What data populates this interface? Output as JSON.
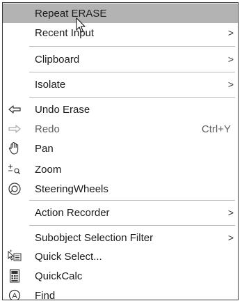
{
  "menu": {
    "items": [
      {
        "label": "Repeat ERASE",
        "icon": "",
        "submenu": false,
        "shortcut": "",
        "highlighted": true
      },
      {
        "label": "Recent Input",
        "icon": "",
        "submenu": true,
        "shortcut": ""
      },
      {
        "label": "Clipboard",
        "icon": "",
        "submenu": true,
        "shortcut": ""
      },
      {
        "label": "Isolate",
        "icon": "",
        "submenu": true,
        "shortcut": ""
      },
      {
        "label": "Undo Erase",
        "icon": "undo-icon",
        "submenu": false,
        "shortcut": ""
      },
      {
        "label": "Redo",
        "icon": "redo-icon",
        "submenu": false,
        "shortcut": "Ctrl+Y",
        "disabled": true
      },
      {
        "label": "Pan",
        "icon": "pan-hand-icon",
        "submenu": false,
        "shortcut": ""
      },
      {
        "label": "Zoom",
        "icon": "zoom-icon",
        "submenu": false,
        "shortcut": ""
      },
      {
        "label": "SteeringWheels",
        "icon": "steeringwheels-icon",
        "submenu": false,
        "shortcut": ""
      },
      {
        "label": "Action Recorder",
        "icon": "",
        "submenu": true,
        "shortcut": ""
      },
      {
        "label": "Subobject Selection Filter",
        "icon": "",
        "submenu": true,
        "shortcut": ""
      },
      {
        "label": "Quick Select...",
        "icon": "quick-select-icon",
        "submenu": false,
        "shortcut": ""
      },
      {
        "label": "QuickCalc",
        "icon": "calculator-icon",
        "submenu": false,
        "shortcut": ""
      },
      {
        "label": "Find",
        "icon": "find-icon",
        "submenu": false,
        "shortcut": ""
      }
    ],
    "chevron": ">"
  },
  "colors": {
    "highlight": "#b3b3b3",
    "border": "#3a3a3a",
    "separator": "#b8b8b8"
  }
}
